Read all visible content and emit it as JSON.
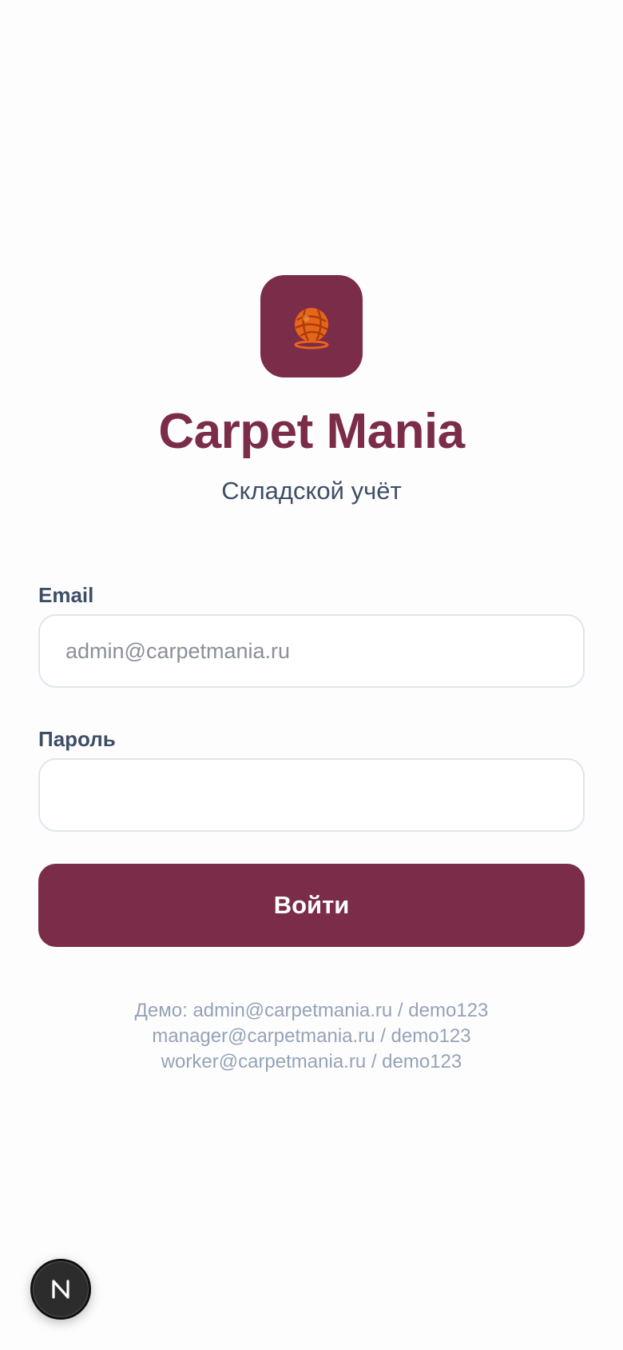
{
  "theme": {
    "accent": "#7b2c48"
  },
  "logo": {
    "icon": "yarn-ball-icon"
  },
  "header": {
    "title": "Carpet Mania",
    "subtitle": "Складской учёт"
  },
  "form": {
    "email_label": "Email",
    "email_placeholder": "admin@carpetmania.ru",
    "email_value": "",
    "password_label": "Пароль",
    "password_value": "",
    "submit_label": "Войти"
  },
  "demo": {
    "lines": [
      "Демо: admin@carpetmania.ru / demo123",
      "manager@carpetmania.ru / demo123",
      "worker@carpetmania.ru / demo123"
    ]
  },
  "dev_badge": {
    "icon": "nextjs-icon",
    "letter": "N"
  }
}
